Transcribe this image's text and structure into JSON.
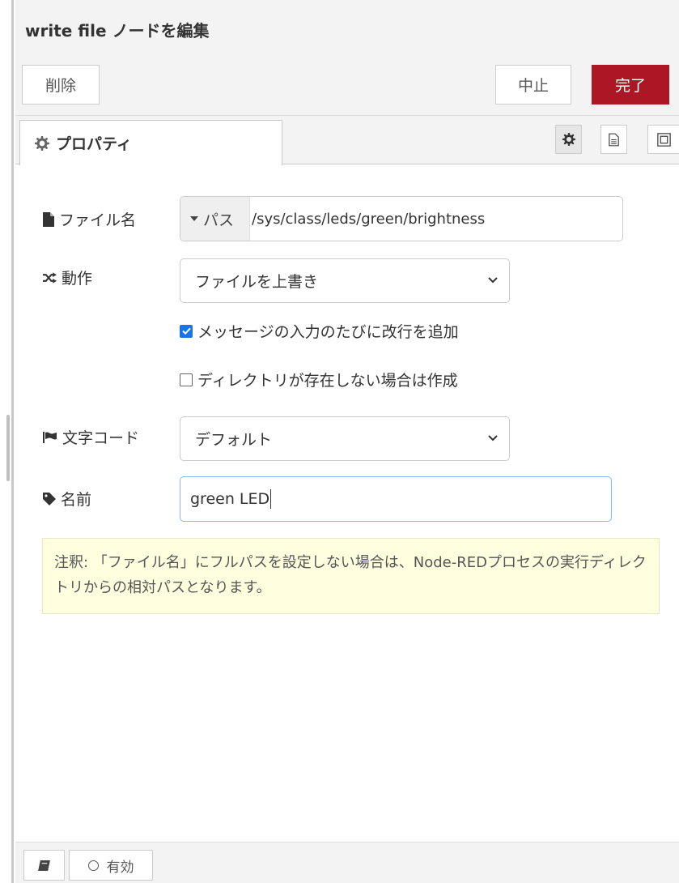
{
  "header": {
    "title": "write file ノードを編集",
    "delete_label": "削除",
    "cancel_label": "中止",
    "done_label": "完了"
  },
  "tabs": [
    {
      "label": "プロパティ",
      "icon": "gear-icon"
    }
  ],
  "tab_icons": [
    "gear-icon",
    "document-icon",
    "frame-icon"
  ],
  "form": {
    "filename": {
      "label": "ファイル名",
      "type_label": "パス",
      "value": "/sys/class/leds/green/brightness"
    },
    "action": {
      "label": "動作",
      "value": "ファイルを上書き"
    },
    "append_newline": {
      "label": "メッセージの入力のたびに改行を追加",
      "checked": true
    },
    "create_dir": {
      "label": "ディレクトリが存在しない場合は作成",
      "checked": false
    },
    "encoding": {
      "label": "文字コード",
      "value": "デフォルト"
    },
    "name": {
      "label": "名前",
      "value": "green LED"
    }
  },
  "tip": {
    "text": "注釈: 「ファイル名」にフルパスを設定しない場合は、Node-REDプロセスの実行ディレクトリからの相対パスとなります。"
  },
  "footer": {
    "enabled_label": "有効"
  },
  "colors": {
    "done_button": "#ad1625",
    "checkbox_on": "#1a73e8",
    "tip_background": "#ffffe0",
    "focus_border": "#85b7ee"
  }
}
